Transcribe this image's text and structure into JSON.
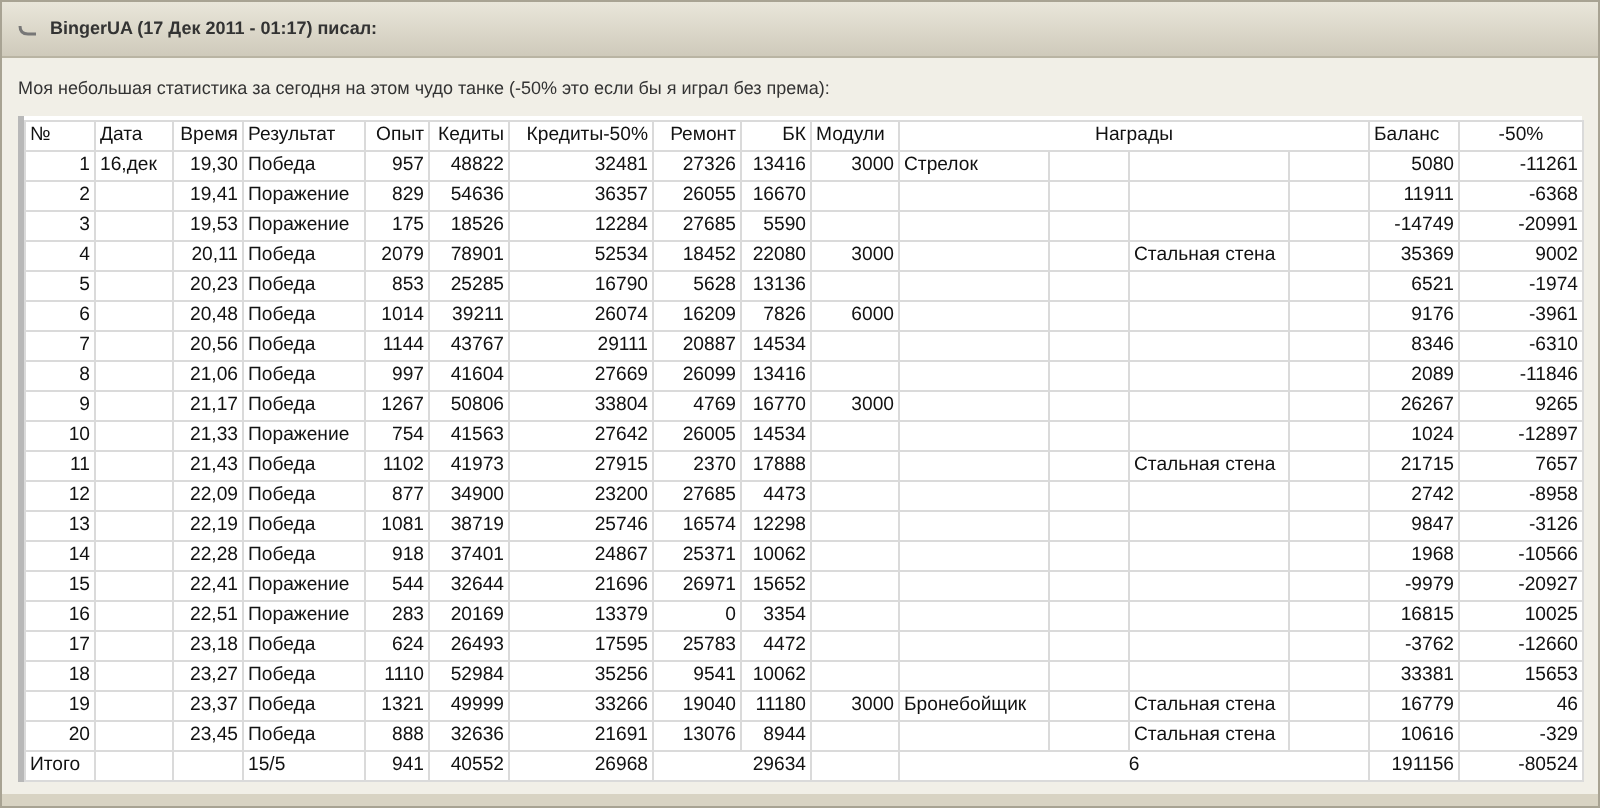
{
  "post": {
    "header": "BingerUA (17 Дек 2011 - 01:17) писал:",
    "intro": "Моя небольшая статистика за сегодня на этом чудо танке (-50% это если бы я играл без према):"
  },
  "table": {
    "columns": [
      "№",
      "Дата",
      "Время",
      "Результат",
      "Опыт",
      "Кедиты",
      "Кредиты-50%",
      "Ремонт",
      "БК",
      "Модули",
      "Награды",
      "Баланс",
      "-50%"
    ],
    "rows": [
      {
        "n": "1",
        "date": "16,дек",
        "time": "19,30",
        "result": "Победа",
        "xp": "957",
        "credits": "48822",
        "credits_half": "32481",
        "repair": "27326",
        "ammo": "13416",
        "modules": "3000",
        "award_1": "Стрелок",
        "balance": "5080",
        "balance_half": "-11261"
      },
      {
        "n": "2",
        "time": "19,41",
        "result": "Поражение",
        "xp": "829",
        "credits": "54636",
        "credits_half": "36357",
        "repair": "26055",
        "ammo": "16670",
        "balance": "11911",
        "balance_half": "-6368"
      },
      {
        "n": "3",
        "time": "19,53",
        "result": "Поражение",
        "xp": "175",
        "credits": "18526",
        "credits_half": "12284",
        "repair": "27685",
        "ammo": "5590",
        "balance": "-14749",
        "balance_half": "-20991"
      },
      {
        "n": "4",
        "time": "20,11",
        "result": "Победа",
        "xp": "2079",
        "credits": "78901",
        "credits_half": "52534",
        "repair": "18452",
        "ammo": "22080",
        "modules": "3000",
        "award_2": "Стальная стена",
        "balance": "35369",
        "balance_half": "9002"
      },
      {
        "n": "5",
        "time": "20,23",
        "result": "Победа",
        "xp": "853",
        "credits": "25285",
        "credits_half": "16790",
        "repair": "5628",
        "ammo": "13136",
        "balance": "6521",
        "balance_half": "-1974"
      },
      {
        "n": "6",
        "time": "20,48",
        "result": "Победа",
        "xp": "1014",
        "credits": "39211",
        "credits_half": "26074",
        "repair": "16209",
        "ammo": "7826",
        "modules": "6000",
        "balance": "9176",
        "balance_half": "-3961"
      },
      {
        "n": "7",
        "time": "20,56",
        "result": "Победа",
        "xp": "1144",
        "credits": "43767",
        "credits_half": "29111",
        "repair": "20887",
        "ammo": "14534",
        "balance": "8346",
        "balance_half": "-6310"
      },
      {
        "n": "8",
        "time": "21,06",
        "result": "Победа",
        "xp": "997",
        "credits": "41604",
        "credits_half": "27669",
        "repair": "26099",
        "ammo": "13416",
        "balance": "2089",
        "balance_half": "-11846"
      },
      {
        "n": "9",
        "time": "21,17",
        "result": "Победа",
        "xp": "1267",
        "credits": "50806",
        "credits_half": "33804",
        "repair": "4769",
        "ammo": "16770",
        "modules": "3000",
        "balance": "26267",
        "balance_half": "9265"
      },
      {
        "n": "10",
        "time": "21,33",
        "result": "Поражение",
        "xp": "754",
        "credits": "41563",
        "credits_half": "27642",
        "repair": "26005",
        "ammo": "14534",
        "balance": "1024",
        "balance_half": "-12897"
      },
      {
        "n": "11",
        "time": "21,43",
        "result": "Победа",
        "xp": "1102",
        "credits": "41973",
        "credits_half": "27915",
        "repair": "2370",
        "ammo": "17888",
        "award_2": "Стальная стена",
        "balance": "21715",
        "balance_half": "7657"
      },
      {
        "n": "12",
        "time": "22,09",
        "result": "Победа",
        "xp": "877",
        "credits": "34900",
        "credits_half": "23200",
        "repair": "27685",
        "ammo": "4473",
        "balance": "2742",
        "balance_half": "-8958"
      },
      {
        "n": "13",
        "time": "22,19",
        "result": "Победа",
        "xp": "1081",
        "credits": "38719",
        "credits_half": "25746",
        "repair": "16574",
        "ammo": "12298",
        "balance": "9847",
        "balance_half": "-3126"
      },
      {
        "n": "14",
        "time": "22,28",
        "result": "Победа",
        "xp": "918",
        "credits": "37401",
        "credits_half": "24867",
        "repair": "25371",
        "ammo": "10062",
        "balance": "1968",
        "balance_half": "-10566"
      },
      {
        "n": "15",
        "time": "22,41",
        "result": "Поражение",
        "xp": "544",
        "credits": "32644",
        "credits_half": "21696",
        "repair": "26971",
        "ammo": "15652",
        "balance": "-9979",
        "balance_half": "-20927"
      },
      {
        "n": "16",
        "time": "22,51",
        "result": "Поражение",
        "xp": "283",
        "credits": "20169",
        "credits_half": "13379",
        "repair": "0",
        "ammo": "3354",
        "balance": "16815",
        "balance_half": "10025"
      },
      {
        "n": "17",
        "time": "23,18",
        "result": "Победа",
        "xp": "624",
        "credits": "26493",
        "credits_half": "17595",
        "repair": "25783",
        "ammo": "4472",
        "balance": "-3762",
        "balance_half": "-12660"
      },
      {
        "n": "18",
        "time": "23,27",
        "result": "Победа",
        "xp": "1110",
        "credits": "52984",
        "credits_half": "35256",
        "repair": "9541",
        "ammo": "10062",
        "balance": "33381",
        "balance_half": "15653"
      },
      {
        "n": "19",
        "time": "23,37",
        "result": "Победа",
        "xp": "1321",
        "credits": "49999",
        "credits_half": "33266",
        "repair": "19040",
        "ammo": "11180",
        "modules": "3000",
        "award_1": "Бронебойщик",
        "award_2": "Стальная стена",
        "balance": "16779",
        "balance_half": "46"
      },
      {
        "n": "20",
        "time": "23,45",
        "result": "Победа",
        "xp": "888",
        "credits": "32636",
        "credits_half": "21691",
        "repair": "13076",
        "ammo": "8944",
        "award_2": "Стальная стена",
        "balance": "10616",
        "balance_half": "-329"
      }
    ],
    "total": {
      "label": "Итого",
      "result": "15/5",
      "xp": "941",
      "credits": "40552",
      "credits_half": "26968",
      "ammo": "29634",
      "awards": "6",
      "balance": "191156",
      "balance_half": "-80524"
    }
  }
}
